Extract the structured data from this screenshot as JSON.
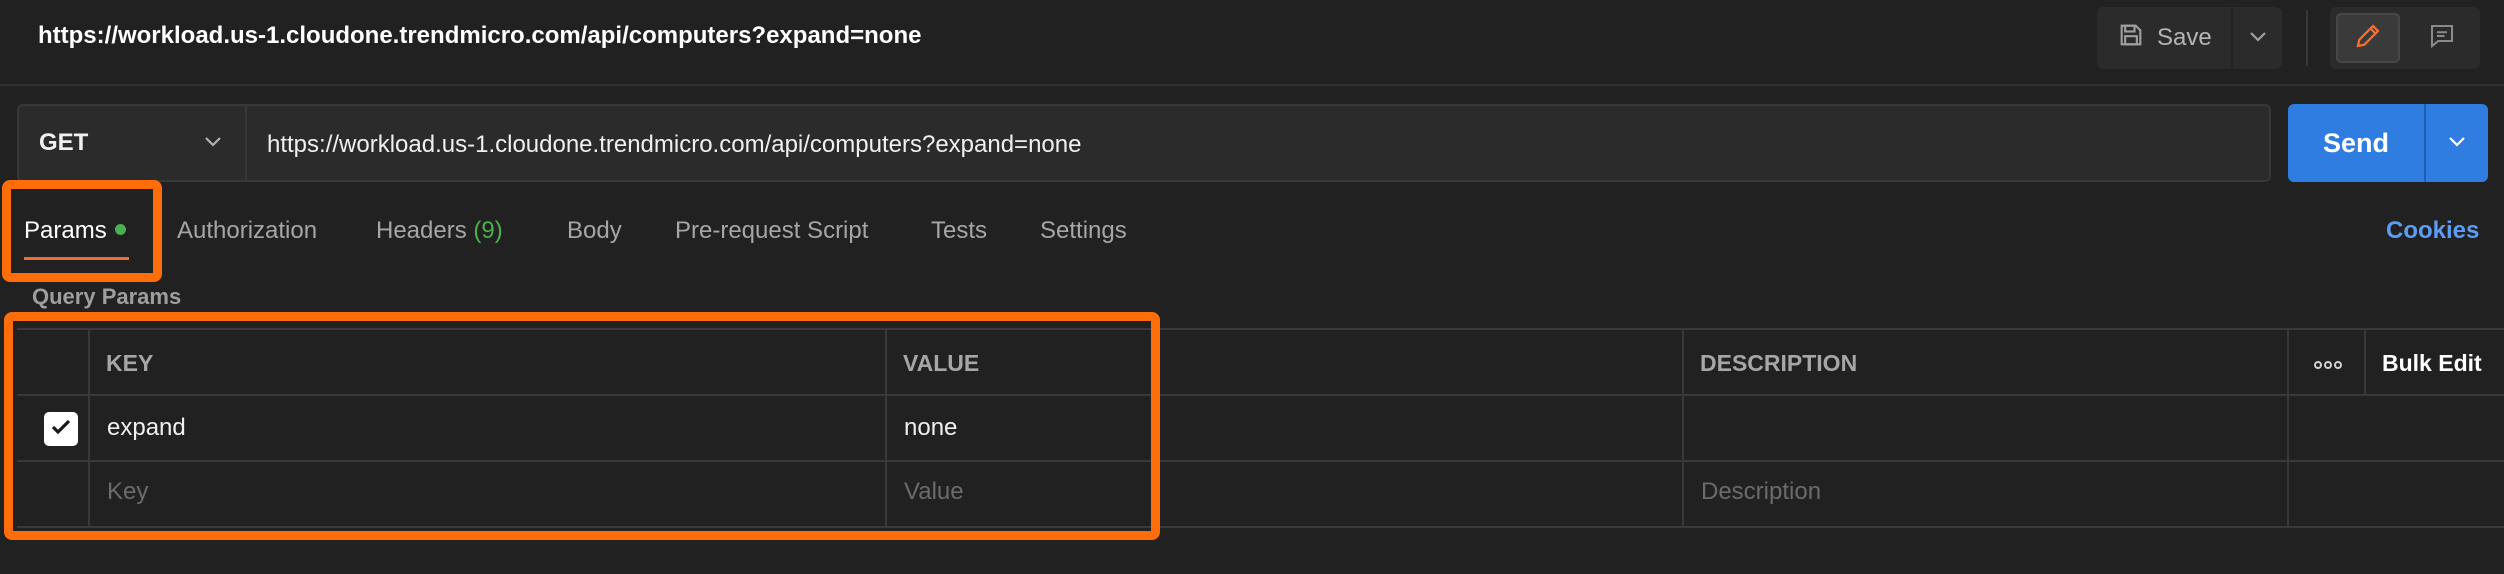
{
  "header": {
    "title": "https://workload.us-1.cloudone.trendmicro.com/api/computers?expand=none",
    "save_label": "Save",
    "icons": [
      "save-icon",
      "chevron-down-icon",
      "pencil-icon",
      "comment-icon"
    ]
  },
  "request": {
    "method": "GET",
    "url": "https://workload.us-1.cloudone.trendmicro.com/api/computers?expand=none",
    "send_label": "Send"
  },
  "tabs": [
    {
      "label": "Params",
      "active": true,
      "indicator": true
    },
    {
      "label": "Authorization"
    },
    {
      "label": "Headers",
      "count": "(9)"
    },
    {
      "label": "Body"
    },
    {
      "label": "Pre-request Script"
    },
    {
      "label": "Tests"
    },
    {
      "label": "Settings"
    }
  ],
  "cookies_label": "Cookies",
  "query_params": {
    "title": "Query Params",
    "columns": {
      "key": "KEY",
      "value": "VALUE",
      "description": "DESCRIPTION",
      "bulk_edit": "Bulk Edit"
    },
    "rows": [
      {
        "checked": true,
        "key": "expand",
        "value": "none",
        "description": ""
      }
    ],
    "placeholders": {
      "key": "Key",
      "value": "Value",
      "description": "Description"
    }
  },
  "colors": {
    "accent_send": "#2f7de1",
    "highlight": "#ff6d0a",
    "tab_underline": "#f26b3a",
    "indicator": "#4caf50",
    "cookies_link": "#5c9cf5"
  }
}
